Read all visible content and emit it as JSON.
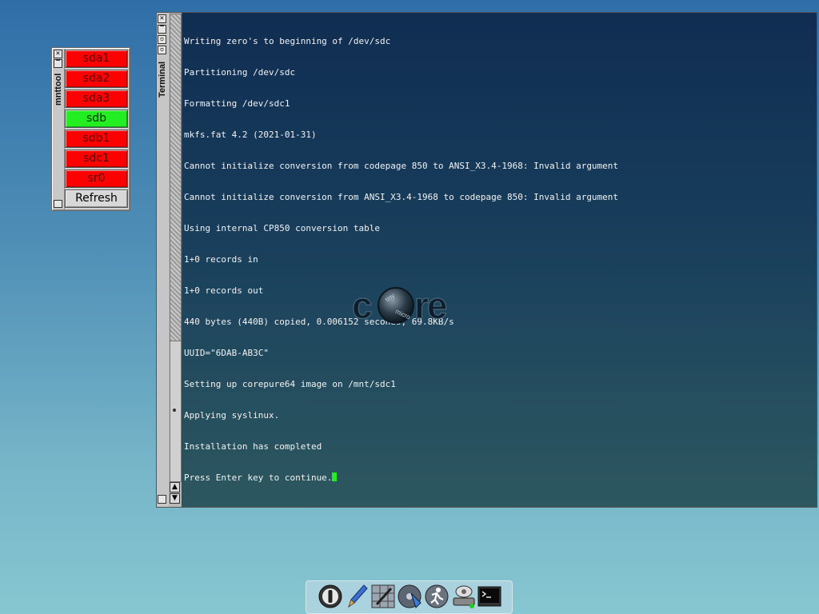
{
  "mnttool": {
    "title": "mnttool",
    "buttons": [
      {
        "label": "sda1",
        "state": "unmounted",
        "color": "#ff0000"
      },
      {
        "label": "sda2",
        "state": "unmounted",
        "color": "#ff0000"
      },
      {
        "label": "sda3",
        "state": "unmounted",
        "color": "#ff0000"
      },
      {
        "label": "sdb",
        "state": "mounted",
        "color": "#22ee22"
      },
      {
        "label": "sdb1",
        "state": "unmounted",
        "color": "#ff0000"
      },
      {
        "label": "sdc1",
        "state": "unmounted",
        "color": "#ff0000"
      },
      {
        "label": "sr0",
        "state": "unmounted",
        "color": "#ff0000"
      }
    ],
    "refresh_label": "Refresh"
  },
  "terminal": {
    "title": "Terminal",
    "lines": [
      "Writing zero's to beginning of /dev/sdc",
      "Partitioning /dev/sdc",
      "Formatting /dev/sdc1",
      "mkfs.fat 4.2 (2021-01-31)",
      "Cannot initialize conversion from codepage 850 to ANSI_X3.4-1968: Invalid argument",
      "Cannot initialize conversion from ANSI_X3.4-1968 to codepage 850: Invalid argument",
      "Using internal CP850 conversion table",
      "1+0 records in",
      "1+0 records out",
      "440 bytes (440B) copied, 0.006152 seconds, 69.8KB/s",
      "UUID=\"6DAB-AB3C\"",
      "Setting up corepure64 image on /mnt/sdc1",
      "Applying syslinux.",
      "Installation has completed"
    ],
    "prompt_line": "Press Enter key to continue.",
    "cursor_color": "#22ee22"
  },
  "wallpaper": {
    "logo_text": "core",
    "logo_badge_top": "tiny",
    "logo_badge_bottom": "micro"
  },
  "dock": {
    "icons": [
      "exit-icon",
      "editor-icon",
      "apps-icon",
      "install-icon",
      "run-icon",
      "mount-icon",
      "terminal-icon"
    ]
  },
  "colors": {
    "unmounted": "#ff0000",
    "mounted": "#22ee22",
    "cursor": "#22ee22"
  }
}
